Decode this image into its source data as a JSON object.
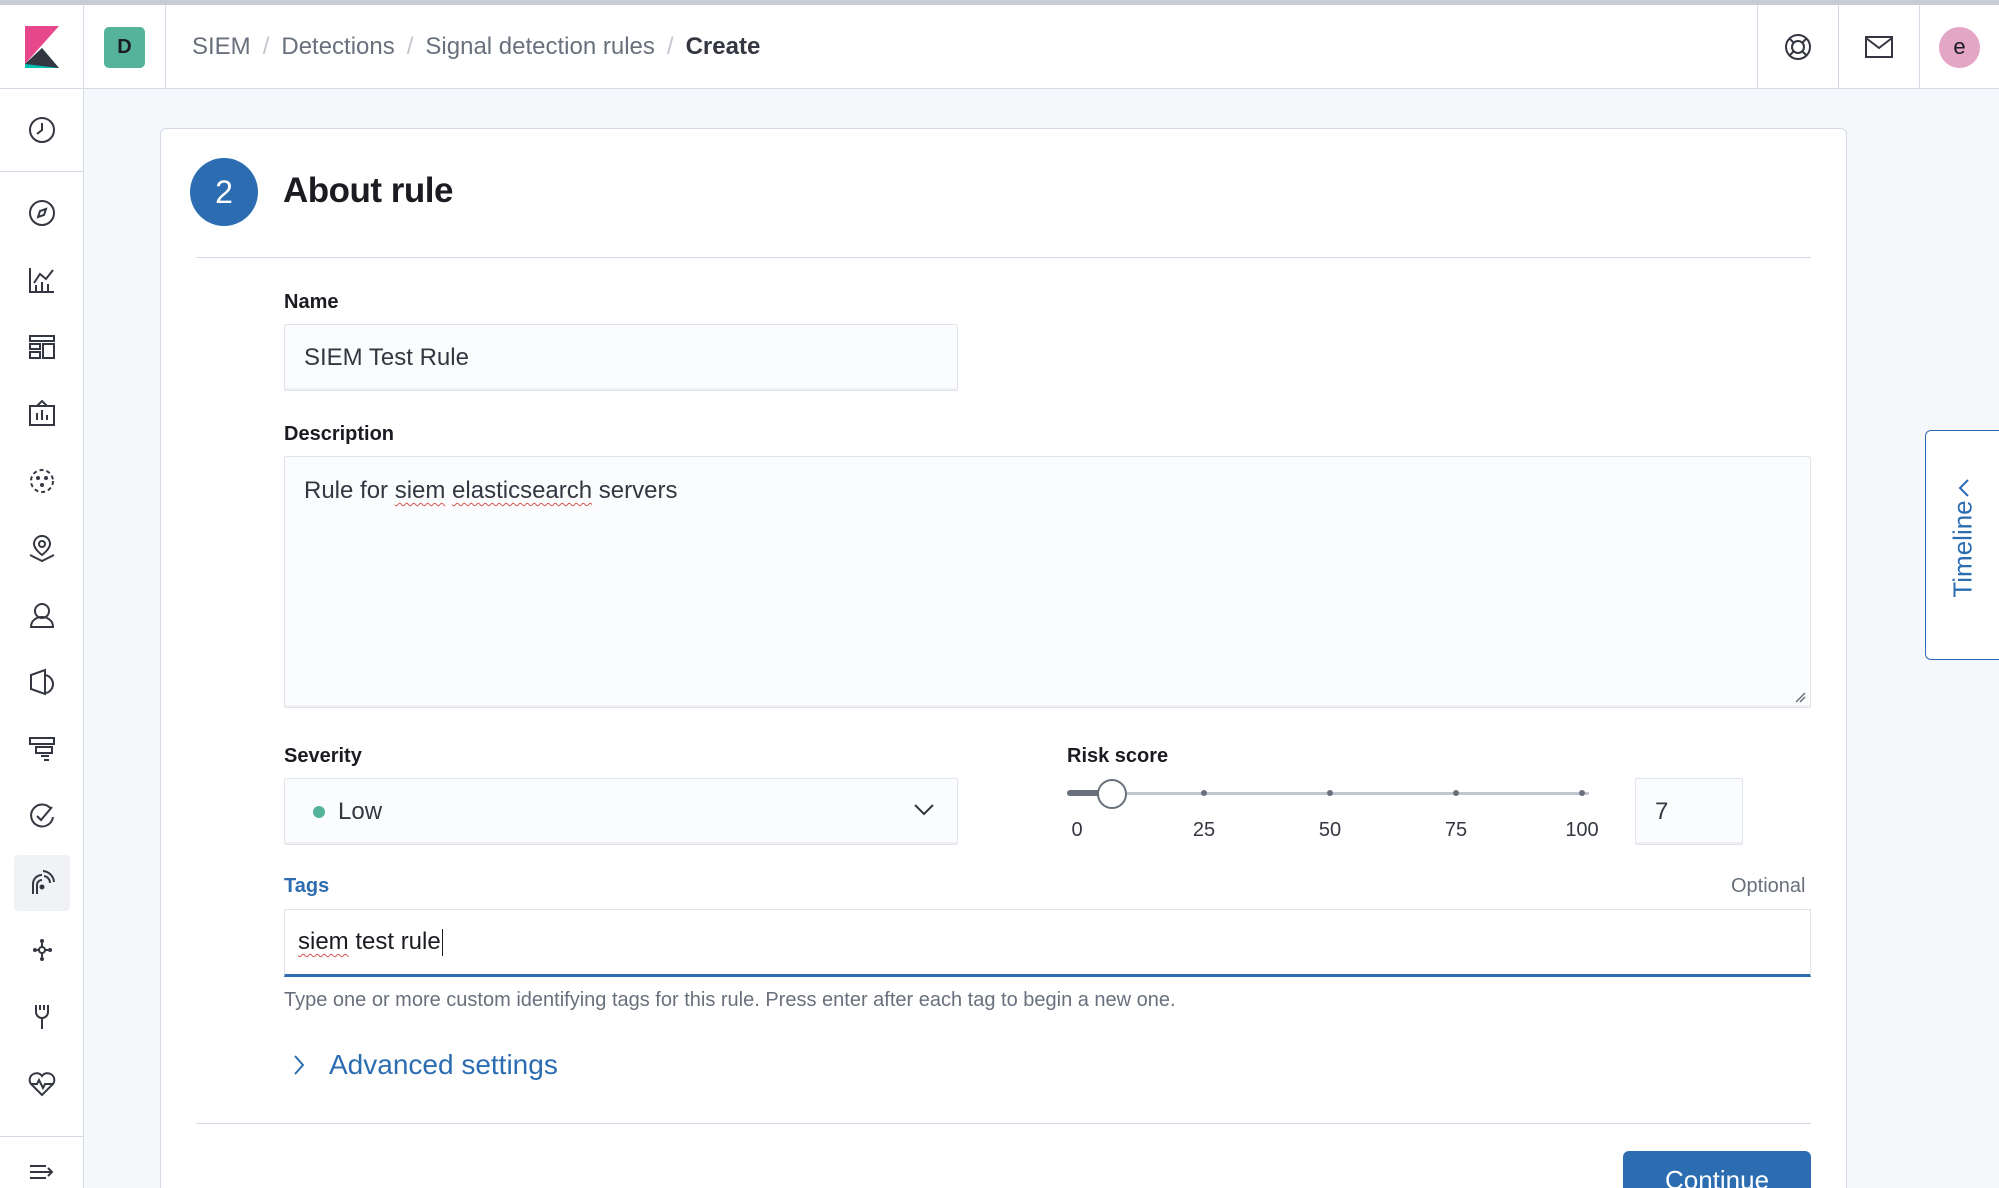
{
  "header": {
    "space_initial": "D",
    "breadcrumbs": [
      "SIEM",
      "Detections",
      "Signal detection rules",
      "Create"
    ],
    "user_initial": "e"
  },
  "sidenav": {
    "items": [
      "recently-viewed-icon",
      "discover-icon",
      "visualize-icon",
      "dashboard-icon",
      "canvas-icon",
      "machine-learning-icon",
      "maps-icon",
      "infrastructure-icon",
      "logs-icon",
      "apm-icon",
      "uptime-icon",
      "siem-icon",
      "graph-icon",
      "dev-tools-icon",
      "monitoring-icon",
      "collapse-icon"
    ],
    "active": "siem-icon"
  },
  "step": {
    "number": "2",
    "title": "About rule"
  },
  "form": {
    "name_label": "Name",
    "name_value": "SIEM Test Rule",
    "description_label": "Description",
    "description_prefix": "Rule for ",
    "description_word1": "siem",
    "description_word2": "elasticsearch",
    "description_suffix": " servers",
    "severity_label": "Severity",
    "severity_value": "Low",
    "severity_color": "#54b399",
    "risk_label": "Risk score",
    "risk_value": "7",
    "risk_ticks": [
      "0",
      "25",
      "50",
      "75",
      "100"
    ],
    "risk_fraction": 0.07,
    "tags_label": "Tags",
    "tags_optional": "Optional",
    "tags_value_word1": "siem",
    "tags_value_rest": " test rule",
    "tags_help": "Type one or more custom identifying tags for this rule. Press enter after each tag to begin a new one.",
    "advanced_label": "Advanced settings",
    "continue_label": "Continue"
  },
  "timeline": {
    "label": "Timeline"
  },
  "colors": {
    "primary": "#2c6db2",
    "accent": "#e7488b"
  }
}
